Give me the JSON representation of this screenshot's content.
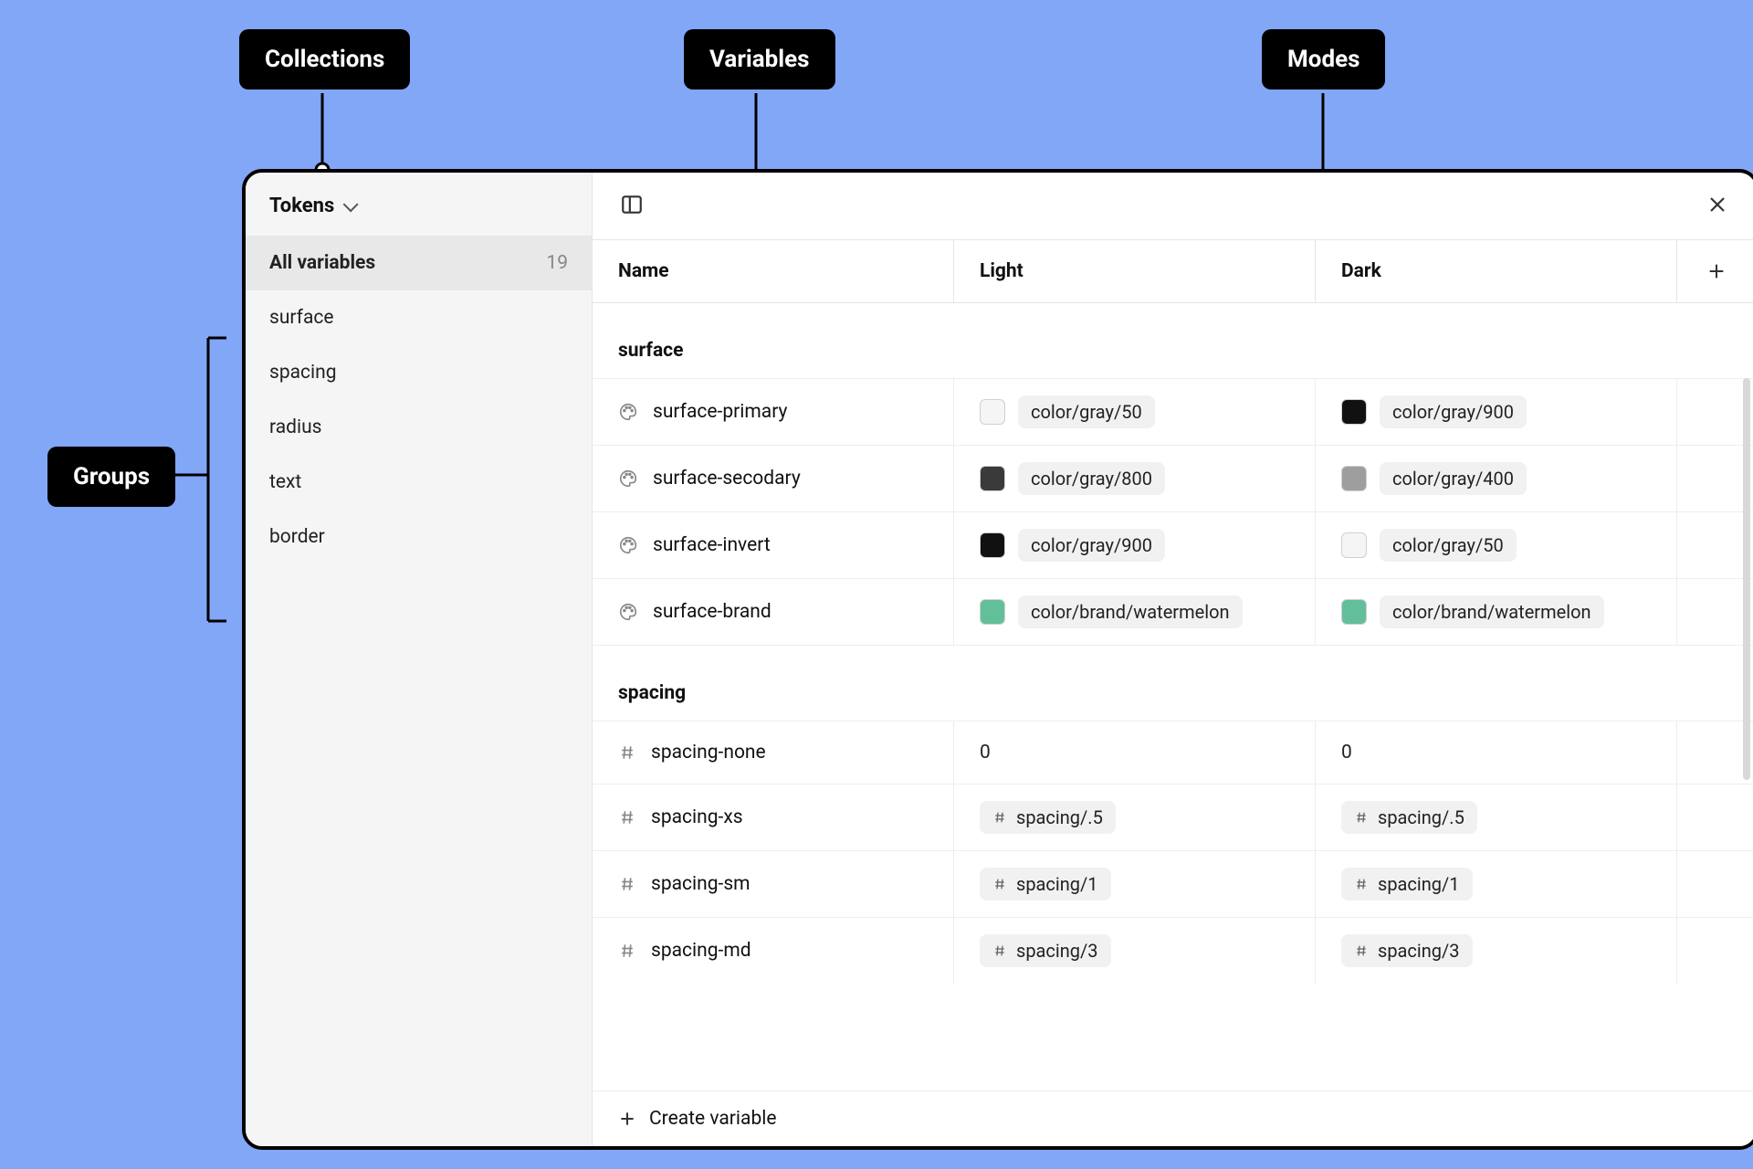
{
  "annotations": {
    "collections": "Collections",
    "variables": "Variables",
    "modes": "Modes",
    "groups": "Groups"
  },
  "sidebar": {
    "collection_name": "Tokens",
    "all_label": "All variables",
    "all_count": "19",
    "groups": [
      "surface",
      "spacing",
      "radius",
      "text",
      "border"
    ]
  },
  "columns": {
    "name": "Name",
    "mode1": "Light",
    "mode2": "Dark"
  },
  "sections": [
    {
      "title": "surface",
      "rows": [
        {
          "type": "color",
          "name": "surface-primary",
          "light": {
            "swatch": "#f5f5f5",
            "alias": "color/gray/50"
          },
          "dark": {
            "swatch": "#111111",
            "alias": "color/gray/900"
          }
        },
        {
          "type": "color",
          "name": "surface-secodary",
          "light": {
            "swatch": "#3a3a3a",
            "alias": "color/gray/800"
          },
          "dark": {
            "swatch": "#9e9e9e",
            "alias": "color/gray/400"
          }
        },
        {
          "type": "color",
          "name": "surface-invert",
          "light": {
            "swatch": "#111111",
            "alias": "color/gray/900"
          },
          "dark": {
            "swatch": "#f5f5f5",
            "alias": "color/gray/50"
          }
        },
        {
          "type": "color",
          "name": "surface-brand",
          "light": {
            "swatch": "#63bf9a",
            "alias": "color/brand/watermelon"
          },
          "dark": {
            "swatch": "#63bf9a",
            "alias": "color/brand/watermelon"
          }
        }
      ]
    },
    {
      "title": "spacing",
      "rows": [
        {
          "type": "number",
          "name": "spacing-none",
          "light": {
            "value": "0"
          },
          "dark": {
            "value": "0"
          }
        },
        {
          "type": "number",
          "name": "spacing-xs",
          "light": {
            "alias": "spacing/.5"
          },
          "dark": {
            "alias": "spacing/.5"
          }
        },
        {
          "type": "number",
          "name": "spacing-sm",
          "light": {
            "alias": "spacing/1"
          },
          "dark": {
            "alias": "spacing/1"
          }
        },
        {
          "type": "number",
          "name": "spacing-md",
          "light": {
            "alias": "spacing/3"
          },
          "dark": {
            "alias": "spacing/3"
          }
        }
      ]
    }
  ],
  "create_label": "Create variable"
}
